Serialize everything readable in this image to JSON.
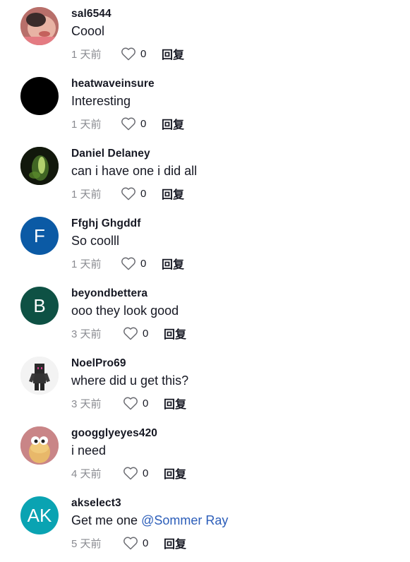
{
  "comments": [
    {
      "username": "sal6544",
      "text": "Coool",
      "time": "1 天前",
      "likes": "0",
      "reply_label": "回复",
      "avatar": {
        "type": "photo",
        "icon": "user-photo-icon",
        "bg": "#c9837b"
      }
    },
    {
      "username": "heatwaveinsure",
      "text": "Interesting",
      "time": "1 天前",
      "likes": "0",
      "reply_label": "回复",
      "avatar": {
        "type": "solid",
        "icon": "user-photo-icon",
        "bg": "#000000"
      }
    },
    {
      "username": "Daniel Delaney",
      "text": "can i have one i did all",
      "time": "1 天前",
      "likes": "0",
      "reply_label": "回复",
      "avatar": {
        "type": "photo",
        "icon": "user-photo-icon",
        "bg": "#1a2410"
      }
    },
    {
      "username": "Ffghj Ghgddf",
      "text": "So coolll",
      "time": "1 天前",
      "likes": "0",
      "reply_label": "回复",
      "avatar": {
        "type": "initials",
        "initials": "F",
        "bg": "#0b5aa5"
      }
    },
    {
      "username": "beyondbettera",
      "text": "ooo they look good",
      "time": "3 天前",
      "likes": "0",
      "reply_label": "回复",
      "avatar": {
        "type": "initials",
        "initials": "B",
        "bg": "#0e5144"
      }
    },
    {
      "username": "NoelPro69",
      "text": "where did u get this?",
      "time": "3 天前",
      "likes": "0",
      "reply_label": "回复",
      "avatar": {
        "type": "photo",
        "icon": "user-photo-icon",
        "bg": "#f1f1f1"
      }
    },
    {
      "username": "googglyeyes420",
      "text": "i need",
      "time": "4 天前",
      "likes": "0",
      "reply_label": "回复",
      "avatar": {
        "type": "photo",
        "icon": "user-photo-icon",
        "bg": "#c98486"
      }
    },
    {
      "username": "akselect3",
      "text": "Get me one",
      "mention": "@Sommer Ray",
      "time": "5 天前",
      "likes": "0",
      "reply_label": "回复",
      "avatar": {
        "type": "initials",
        "initials": "AK",
        "bg": "#0aa3b2"
      }
    }
  ],
  "colors": {
    "text_primary": "#161823",
    "text_secondary": "#8a8b91",
    "mention": "#2b5db9"
  }
}
